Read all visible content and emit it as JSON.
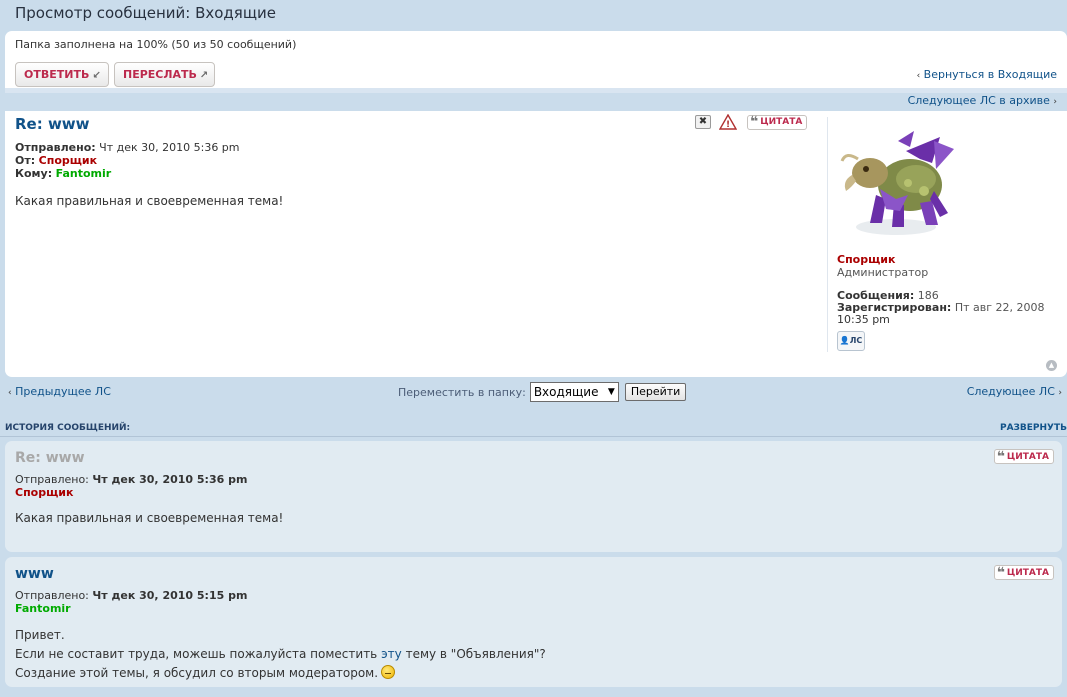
{
  "page": {
    "title": "Просмотр сообщений: Входящие"
  },
  "folder": {
    "status": "Папка заполнена на 100% (50 из 50 сообщений)"
  },
  "toolbar": {
    "reply_label": "ОТВЕТИТЬ",
    "forward_label": "ПЕРЕСЛАТЬ",
    "back_link": "Вернуться в Входящие",
    "next_archive": "Следующее ЛС в архиве"
  },
  "message": {
    "title": "Re: www",
    "sent_label": "Отправлено:",
    "sent_value": "Чт дек 30, 2010 5:36 pm",
    "from_label": "От:",
    "from_value": "Спорщик",
    "to_label": "Кому:",
    "to_value": "Fantomir",
    "body": "Какая правильная и своевременная тема!",
    "quote_label": "ЦИТАТА",
    "delete_icon": "✖",
    "report_icon": "!"
  },
  "profile": {
    "name": "Спорщик",
    "rank": "Администратор",
    "posts_label": "Сообщения:",
    "posts_value": "186",
    "registered_label": "Зарегистрирован:",
    "registered_value": "Пт авг 22, 2008",
    "registered_time": "10:35 pm",
    "pm_label": "ЛС"
  },
  "nav": {
    "prev": "Предыдущее ЛС",
    "next": "Следующее ЛС",
    "move_label": "Переместить в папку:",
    "move_selected": "Входящие",
    "go_label": "Перейти"
  },
  "history": {
    "title": "ИСТОРИЯ СООБЩЕНИЙ:",
    "toggle": "РАЗВЕРНУТЬ",
    "posts": [
      {
        "title": "Re: www",
        "sent_label": "Отправлено:",
        "sent_value": "Чт дек 30, 2010 5:36 pm",
        "author": "Спорщик",
        "quote_label": "ЦИТАТА",
        "body": "Какая правильная и своевременная тема!"
      },
      {
        "title": "www",
        "sent_label": "Отправлено:",
        "sent_value": "Чт дек 30, 2010 5:15 pm",
        "author": "Fantomir",
        "quote_label": "ЦИТАТА",
        "line1": "Привет.",
        "line2_a": "Если не составит труда, можешь пожалуйста поместить ",
        "line2_link": "эту",
        "line2_b": " тему в \"Объявления\"?",
        "line3": "Создание этой темы, я обсудил со вторым модератором."
      }
    ]
  },
  "colors": {
    "background": "#cadceb",
    "link": "#105289",
    "admin": "#aa0000",
    "user": "#00aa00",
    "button_text": "#bc2a4d"
  }
}
